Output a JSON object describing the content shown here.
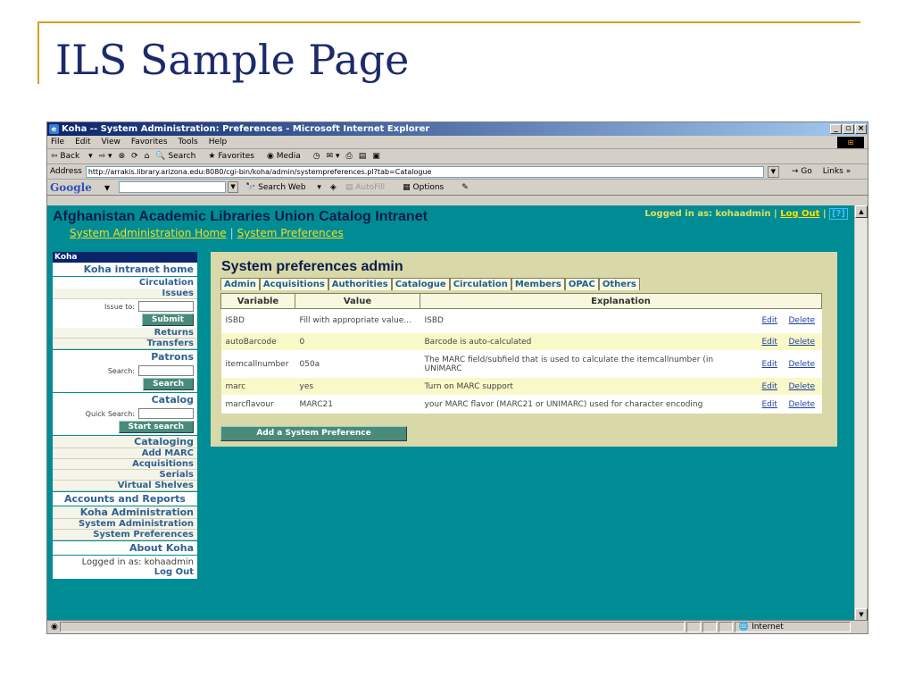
{
  "slide": {
    "title": "ILS Sample Page"
  },
  "window": {
    "title": "Koha -- System Administration: Preferences - Microsoft Internet Explorer",
    "menu": [
      "File",
      "Edit",
      "View",
      "Favorites",
      "Tools",
      "Help"
    ],
    "toolbar": [
      "Back",
      "Search",
      "Favorites",
      "Media"
    ],
    "address_label": "Address",
    "url": "http://arrakis.library.arizona.edu:8080/cgi-bin/koha/admin/systempreferences.pl?tab=Catalogue",
    "go_label": "Go",
    "links_label": "Links",
    "google": {
      "logo": "Google",
      "search_web": "Search Web",
      "autofill": "AutoFill",
      "options": "Options"
    },
    "status_zone": "Internet"
  },
  "site": {
    "title": "Afghanistan Academic Libraries Union Catalog Intranet",
    "links": [
      "System Administration Home",
      "System Preferences"
    ],
    "logged_in_text": "Logged in as: kohaadmin",
    "logout": "Log Out",
    "help": "[?]"
  },
  "sidebar": {
    "header": "Koha",
    "intranet_home": "Koha intranet home",
    "circulation": "Circulation",
    "issues": "Issues",
    "issue_to_label": "Issue to:",
    "submit": "Submit",
    "returns": "Returns",
    "transfers": "Transfers",
    "patrons": "Patrons",
    "search_label": "Search:",
    "search_btn": "Search",
    "catalog": "Catalog",
    "quick_search_label": "Quick Search:",
    "start_search": "Start search",
    "cataloging": "Cataloging",
    "add_marc": "Add MARC",
    "acquisitions": "Acquisitions",
    "serials": "Serials",
    "virtual_shelves": "Virtual Shelves",
    "accounts": "Accounts and Reports",
    "koha_admin": "Koha Administration",
    "system_admin": "System Administration",
    "system_prefs": "System Preferences",
    "about": "About Koha",
    "logged_in": "Logged in as: kohaadmin",
    "log_out": "Log Out"
  },
  "panel": {
    "title": "System preferences admin",
    "tabs": [
      "Admin",
      "Acquisitions",
      "Authorities",
      "Catalogue",
      "Circulation",
      "Members",
      "OPAC",
      "Others"
    ],
    "headers": [
      "Variable",
      "Value",
      "Explanation"
    ],
    "rows": [
      {
        "variable": "ISBD",
        "value": "Fill with appropriate value...",
        "explanation": "ISBD",
        "edit": "Edit",
        "delete": "Delete"
      },
      {
        "variable": "autoBarcode",
        "value": "0",
        "explanation": "Barcode is auto-calculated",
        "edit": "Edit",
        "delete": "Delete"
      },
      {
        "variable": "itemcallnumber",
        "value": "050a",
        "explanation": "The MARC field/subfield that is used to calculate the itemcallnumber (in UNIMARC",
        "edit": "Edit",
        "delete": "Delete"
      },
      {
        "variable": "marc",
        "value": "yes",
        "explanation": "Turn on MARC support",
        "edit": "Edit",
        "delete": "Delete"
      },
      {
        "variable": "marcflavour",
        "value": "MARC21",
        "explanation": "your MARC flavor (MARC21 or UNIMARC) used for character encoding",
        "edit": "Edit",
        "delete": "Delete"
      }
    ],
    "add_button": "Add a System Preference"
  }
}
